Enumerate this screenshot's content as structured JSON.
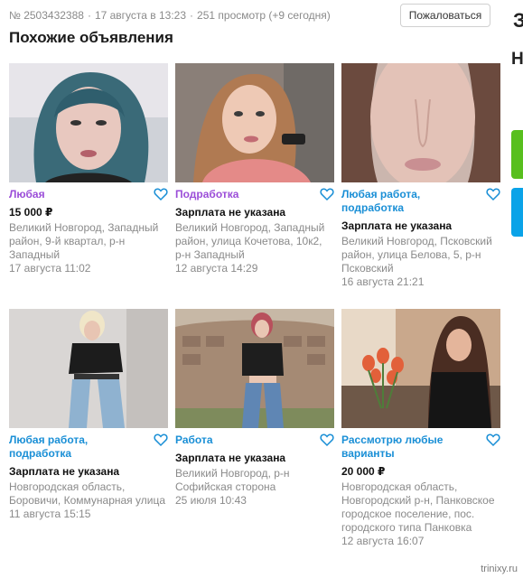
{
  "meta": {
    "ad_number": "№ 2503432388",
    "posted": "17 августа в 13:23",
    "views": "251 просмотр (+9 сегодня)"
  },
  "report_button": "Пожаловаться",
  "heading": "Похожие объявления",
  "edge": {
    "char1": "З",
    "char2": "Н"
  },
  "colors": {
    "purple": "#9b4dd8",
    "blue": "#1a8fd6",
    "green": "#58bf1e",
    "cyan": "#0aa3e8"
  },
  "cards": [
    {
      "title": "Любая",
      "price": "15 000 ₽",
      "address": "Великий Новгород, Западный район, 9-й квартал, р-н Западный",
      "date": "17 августа 11:02"
    },
    {
      "title": "Подработка",
      "price": "Зарплата не указана",
      "address": "Великий Новгород, Западный район, улица Кочетова, 10к2, р-н Западный",
      "date": "12 августа 14:29"
    },
    {
      "title": "Любая работа, подработка",
      "price": "Зарплата не указана",
      "address": "Великий Новгород, Псковский район, улица Белова, 5, р-н Псковский",
      "date": "16 августа 21:21"
    },
    {
      "title": "Любая работа, подработка",
      "price": "Зарплата не указана",
      "address": "Новгородская область, Боровичи, Коммунарная улица",
      "date": "11 августа 15:15"
    },
    {
      "title": "Работа",
      "price": "Зарплата не указана",
      "address": "Великий Новгород, р-н Софийская сторона",
      "date": "25 июля 10:43"
    },
    {
      "title": "Рассмотрю любые варианты",
      "price": "20 000 ₽",
      "address": "Новгородская область, Новгородский р-н, Панковское городское поселение, пос. городского типа Панковка",
      "date": "12 августа 16:07"
    }
  ],
  "watermark": "trinixy.ru"
}
